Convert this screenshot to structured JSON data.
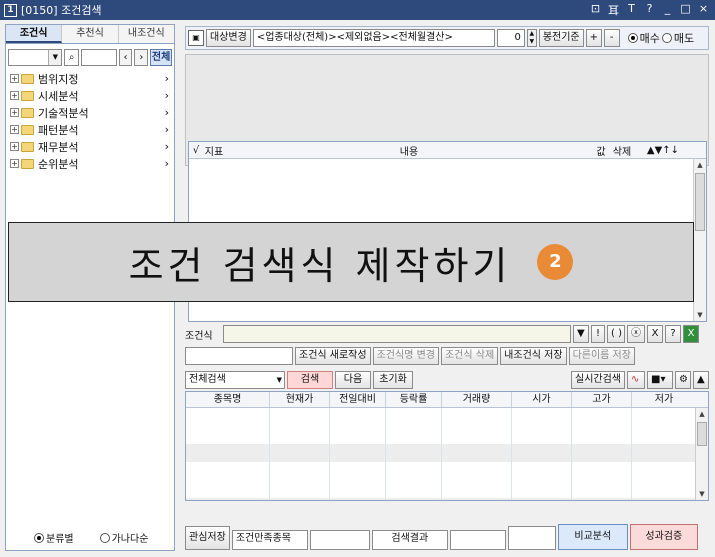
{
  "titlebar": {
    "num": "1",
    "title": "[0150] 조건검색",
    "controls": [
      "⊡",
      "耳",
      "T",
      "?",
      "_",
      "□",
      "×"
    ]
  },
  "left": {
    "tabs": [
      "조건식",
      "추천식",
      "내조건식"
    ],
    "search": {
      "full_btn": "전체"
    },
    "tree": [
      "범위지정",
      "시세분석",
      "기술적분석",
      "패턴분석",
      "재무분석",
      "순위분석"
    ],
    "radio": [
      "분류별",
      "가나다순"
    ]
  },
  "toolbar": {
    "target_btn": "대상변경",
    "target_value": "<업종대상(전체)><제외없음><전체월결산>",
    "count": "0",
    "basis": "봉전기준",
    "plus": "+",
    "minus": "-",
    "buy": "매수",
    "sell": "매도"
  },
  "grid1": {
    "headers": [
      "√",
      "지표",
      "내용",
      "값",
      "삭제",
      "▲▼↑↓"
    ]
  },
  "overlay": {
    "text": "조건 검색식 제작하기",
    "badge": "2"
  },
  "cond": {
    "label": "조건식",
    "buttons": [
      "!",
      "( )",
      "ⓧ",
      "X",
      "?"
    ]
  },
  "row3": {
    "new_btn": "조건식 새로작성",
    "rename_btn": "조건식명 변경",
    "delete_btn": "조건식 삭제",
    "save_btn": "내조건식 저장",
    "save_as_btn": "다른이름 저장"
  },
  "row4": {
    "select": "전체검색",
    "search_btn": "검색",
    "next_btn": "다음",
    "reset_btn": "초기화",
    "realtime_btn": "실시간검색"
  },
  "grid2": {
    "headers": [
      "종목명",
      "현재가",
      "전일대비",
      "등락률",
      "거래량",
      "시가",
      "고가",
      "저가"
    ]
  },
  "bottom": {
    "save_interest": "관심저장",
    "match_label": "조건만족종목",
    "result_label": "검색결과",
    "compare_btn": "비교분석",
    "verify_btn": "성과검증"
  },
  "colors": {
    "title": "#2e4a7d",
    "badge": "#e98a37",
    "search_btn": "#ffd7d7"
  }
}
